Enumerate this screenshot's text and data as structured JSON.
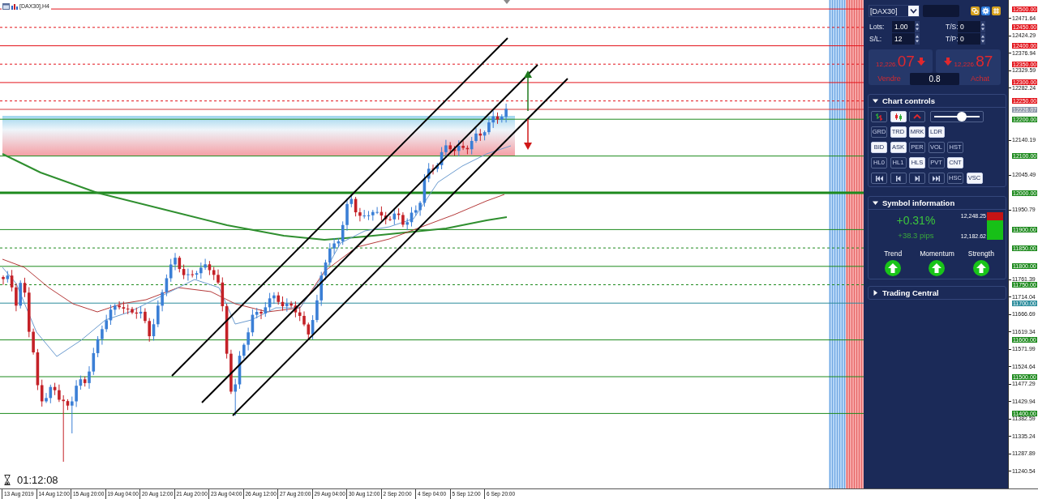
{
  "window": {
    "title": "[DAX30],H4"
  },
  "timer": "01:12:08",
  "price_levels": [
    {
      "label": "12500.00",
      "color": "#e3141b",
      "kind": "solid"
    },
    {
      "label": "12450.00",
      "color": "#e3141b",
      "kind": "dashed"
    },
    {
      "label": "12400.00",
      "color": "#e3141b",
      "kind": "solid"
    },
    {
      "label": "12350.00",
      "color": "#e3141b",
      "kind": "dashed"
    },
    {
      "label": "12300.00",
      "color": "#e3141b",
      "kind": "solid"
    },
    {
      "label": "12250.00",
      "color": "#e3141b",
      "kind": "dashed"
    },
    {
      "label": "12226.07",
      "color": "#8c96a8",
      "kind": "price"
    },
    {
      "label": "12200.00",
      "color": "#1d8a1d",
      "kind": "solid"
    },
    {
      "label": "12100.00",
      "color": "#1d8a1d",
      "kind": "solid"
    },
    {
      "label": "12000.00",
      "color": "#1d8a1d",
      "kind": "thick"
    },
    {
      "label": "11900.00",
      "color": "#1d8a1d",
      "kind": "solid"
    },
    {
      "label": "11850.00",
      "color": "#1d8a1d",
      "kind": "dashed"
    },
    {
      "label": "11800.00",
      "color": "#1d8a1d",
      "kind": "solid"
    },
    {
      "label": "11750.00",
      "color": "#1d8a1d",
      "kind": "dashed"
    },
    {
      "label": "11700.00",
      "color": "#2b8c9c",
      "kind": "solid"
    },
    {
      "label": "11600.00",
      "color": "#1d8a1d",
      "kind": "solid"
    },
    {
      "label": "11500.00",
      "color": "#1d8a1d",
      "kind": "solid"
    },
    {
      "label": "11400.00",
      "color": "#1d8a1d",
      "kind": "solid"
    }
  ],
  "price_ticks": [
    "12471.64",
    "12424.29",
    "12376.94",
    "12329.59",
    "12282.24",
    "12140.19",
    "12045.49",
    "11950.79",
    "11761.39",
    "11714.04",
    "11666.69",
    "11619.34",
    "11571.99",
    "11524.64",
    "11477.29",
    "11429.94",
    "11382.59",
    "11335.24",
    "11287.89",
    "11240.54"
  ],
  "time_labels": [
    "13 Aug 2019",
    "14 Aug 12:00",
    "15 Aug 20:00",
    "19 Aug 04:00",
    "20 Aug 12:00",
    "21 Aug 20:00",
    "23 Aug 04:00",
    "26 Aug 12:00",
    "27 Aug 20:00",
    "29 Aug 04:00",
    "30 Aug 12:00",
    "2 Sep 20:00",
    "4 Sep 04:00",
    "5 Sep 12:00",
    "6 Sep 20:00"
  ],
  "panel": {
    "symbol": "[DAX30]",
    "order_fields": [
      {
        "label": "Lots:",
        "value": "1.00"
      },
      {
        "label": "T/S:",
        "value": "0"
      },
      {
        "label": "S/L:",
        "value": "12"
      },
      {
        "label": "T/P:",
        "value": "0"
      }
    ],
    "trade_buttons": [
      {
        "kind": "sell",
        "price_small": "12,226.",
        "price_big": "07",
        "label": "Vendre"
      },
      {
        "kind": "buy",
        "price_small": "12,226.",
        "price_big": "87",
        "label": "Achat"
      }
    ],
    "spread": "0.8",
    "chart_controls": {
      "title": "Chart controls",
      "expanded": true,
      "chart_types": [
        {
          "kind": "bars",
          "selected": false
        },
        {
          "kind": "candles",
          "selected": true
        },
        {
          "kind": "line",
          "selected": false
        }
      ],
      "zoom_slider": {
        "level": 0.6
      },
      "button_rows": [
        [
          {
            "kind": "text",
            "label": "GRD",
            "on": false
          },
          {
            "kind": "text",
            "label": "TRD",
            "on": true
          },
          {
            "kind": "text",
            "label": "MRK",
            "on": true
          },
          {
            "kind": "text",
            "label": "LDR",
            "on": true
          }
        ],
        [
          {
            "kind": "text",
            "label": "BID",
            "on": true
          },
          {
            "kind": "text",
            "label": "ASK",
            "on": true
          },
          {
            "kind": "text",
            "label": "PER",
            "on": false
          },
          {
            "kind": "text",
            "label": "VOL",
            "on": false
          },
          {
            "kind": "text",
            "label": "HST",
            "on": false
          }
        ],
        [
          {
            "kind": "text",
            "label": "HL0",
            "on": false
          },
          {
            "kind": "text",
            "label": "HL1",
            "on": false
          },
          {
            "kind": "text",
            "label": "HLS",
            "on": true
          },
          {
            "kind": "text",
            "label": "PVT",
            "on": false
          },
          {
            "kind": "text",
            "label": "CNT",
            "on": true
          }
        ],
        [
          {
            "kind": "first",
            "on": false
          },
          {
            "kind": "prev",
            "on": false
          },
          {
            "kind": "next",
            "on": false
          },
          {
            "kind": "last",
            "on": false
          },
          {
            "kind": "text",
            "label": "HSC",
            "on": false
          },
          {
            "kind": "text",
            "label": "VSC",
            "on": true
          }
        ]
      ]
    },
    "symbol_information": {
      "title": "Symbol information",
      "expanded": true,
      "change_percent": "+0.31%",
      "change_pips": "+38.3 pips",
      "high": "12,248.25",
      "low": "12,182.62",
      "range_bar": {
        "level": 0.7
      },
      "indicators": [
        {
          "label": "Trend",
          "up": true
        },
        {
          "label": "Momentum",
          "up": true
        },
        {
          "label": "Strength",
          "up": true
        }
      ]
    },
    "trading_central": {
      "title": "Trading Central",
      "expanded": false
    }
  }
}
